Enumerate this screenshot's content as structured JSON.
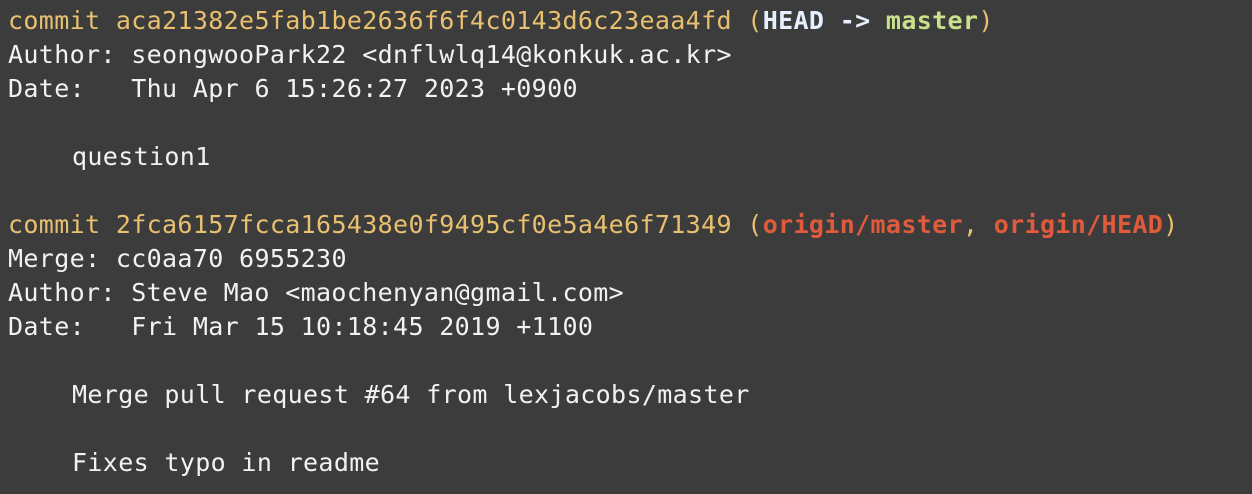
{
  "commits": [
    {
      "keyword": "commit",
      "hash": "aca21382e5fab1be2636f6f4c0143d6c23eaa4fd",
      "paren_open": "(",
      "refs": [
        {
          "label": "HEAD",
          "arrow": " -> "
        },
        {
          "label": "master"
        }
      ],
      "paren_close": ")",
      "author_label": "Author:",
      "author": "seongwooPark22 <dnflwlq14@konkuk.ac.kr>",
      "date_label": "Date:",
      "date": "Thu Apr 6 15:26:27 2023 +0900",
      "message": [
        "question1"
      ]
    },
    {
      "keyword": "commit",
      "hash": "2fca6157fcca165438e0f9495cf0e5a4e6f71349",
      "paren_open": "(",
      "refs": [
        {
          "label": "origin/master",
          "sep": ", "
        },
        {
          "label": "origin/HEAD"
        }
      ],
      "paren_close": ")",
      "merge_label": "Merge:",
      "merge": "cc0aa70 6955230",
      "author_label": "Author:",
      "author": "Steve Mao <maochenyan@gmail.com>",
      "date_label": "Date:",
      "date": "Fri Mar 15 10:18:45 2019 +1100",
      "message": [
        "Merge pull request #64 from lexjacobs/master",
        "Fixes typo in readme"
      ]
    }
  ],
  "colors": {
    "background": "#3c3c3c",
    "text": "#f2f2f2",
    "commit_line": "#e8c06f",
    "head_ref": "#e6f0ff",
    "local_branch": "#c9e08d",
    "remote_branch": "#e05a3c"
  }
}
